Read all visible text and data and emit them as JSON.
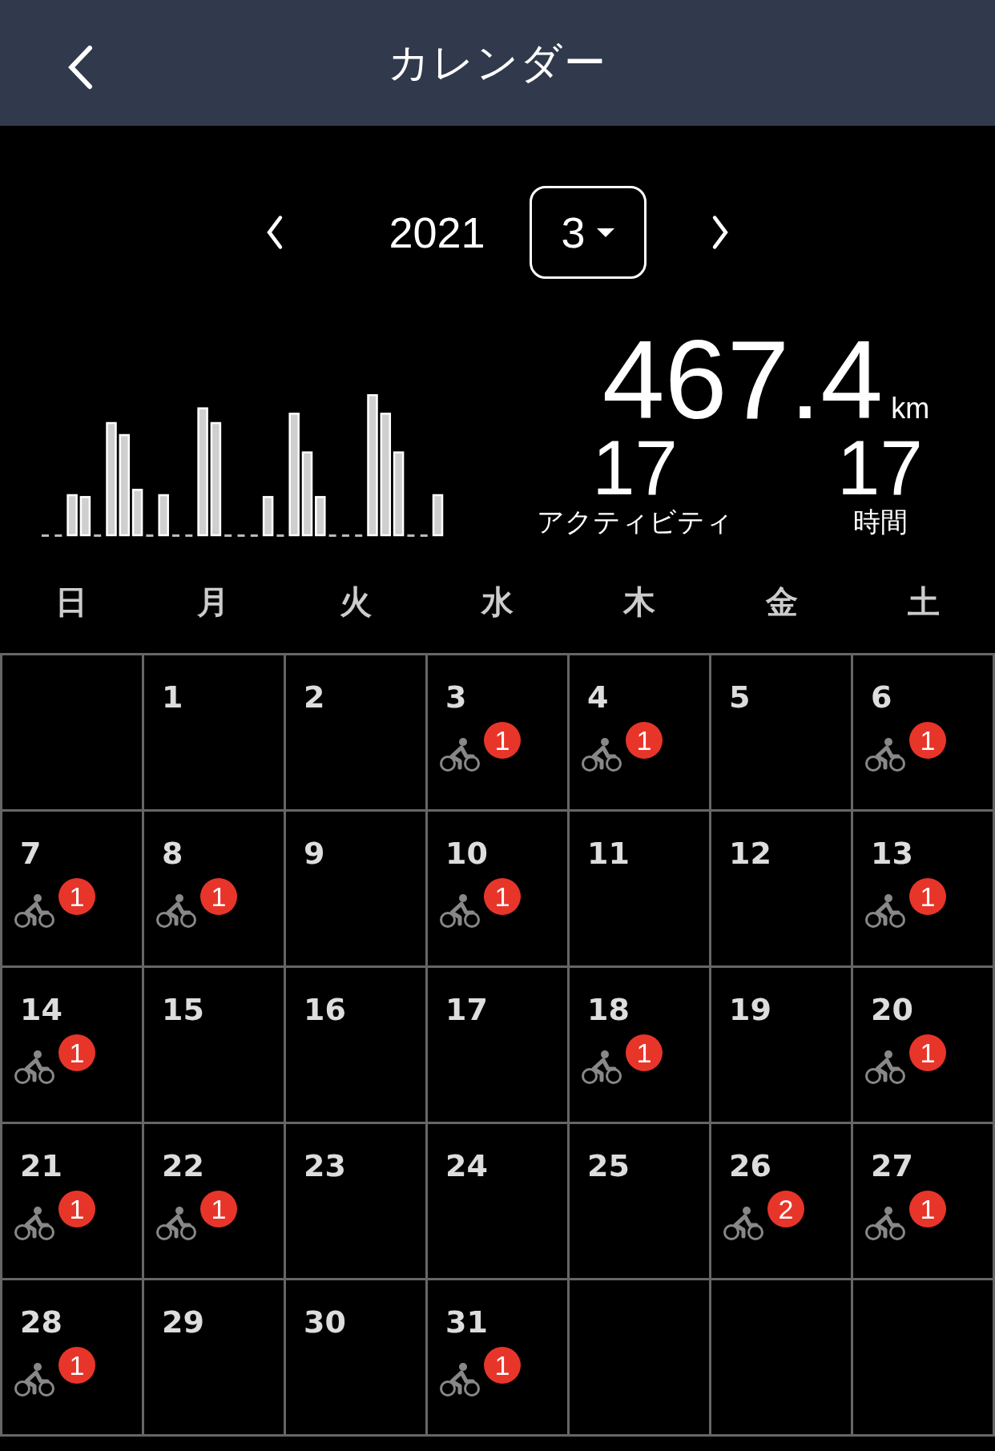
{
  "header": {
    "title": "カレンダー"
  },
  "month_nav": {
    "year": "2021",
    "month": "3"
  },
  "summary": {
    "distance": "467.4",
    "unit": "km",
    "activities": {
      "value": "17",
      "label": "アクティビティ"
    },
    "hours": {
      "value": "17",
      "label": "時間"
    }
  },
  "weekdays": [
    "日",
    "月",
    "火",
    "水",
    "木",
    "金",
    "土"
  ],
  "cells": [
    {
      "kind": "blank"
    },
    {
      "kind": "day",
      "day": "1"
    },
    {
      "kind": "day",
      "day": "2"
    },
    {
      "kind": "day",
      "day": "3",
      "count": "1"
    },
    {
      "kind": "day",
      "day": "4",
      "count": "1"
    },
    {
      "kind": "day",
      "day": "5"
    },
    {
      "kind": "day",
      "day": "6",
      "count": "1"
    },
    {
      "kind": "day",
      "day": "7",
      "count": "1"
    },
    {
      "kind": "day",
      "day": "8",
      "count": "1"
    },
    {
      "kind": "day",
      "day": "9"
    },
    {
      "kind": "day",
      "day": "10",
      "count": "1"
    },
    {
      "kind": "day",
      "day": "11"
    },
    {
      "kind": "day",
      "day": "12"
    },
    {
      "kind": "day",
      "day": "13",
      "count": "1"
    },
    {
      "kind": "day",
      "day": "14",
      "count": "1"
    },
    {
      "kind": "day",
      "day": "15"
    },
    {
      "kind": "day",
      "day": "16"
    },
    {
      "kind": "day",
      "day": "17"
    },
    {
      "kind": "day",
      "day": "18",
      "count": "1"
    },
    {
      "kind": "day",
      "day": "19"
    },
    {
      "kind": "day",
      "day": "20",
      "count": "1"
    },
    {
      "kind": "day",
      "day": "21",
      "count": "1"
    },
    {
      "kind": "day",
      "day": "22",
      "count": "1"
    },
    {
      "kind": "day",
      "day": "23"
    },
    {
      "kind": "day",
      "day": "24"
    },
    {
      "kind": "day",
      "day": "25"
    },
    {
      "kind": "day",
      "day": "26",
      "count": "2"
    },
    {
      "kind": "day",
      "day": "27",
      "count": "1"
    },
    {
      "kind": "day",
      "day": "28",
      "count": "1"
    },
    {
      "kind": "day",
      "day": "29"
    },
    {
      "kind": "day",
      "day": "30"
    },
    {
      "kind": "day",
      "day": "31",
      "count": "1"
    },
    {
      "kind": "blank"
    },
    {
      "kind": "blank"
    },
    {
      "kind": "blank"
    }
  ]
}
